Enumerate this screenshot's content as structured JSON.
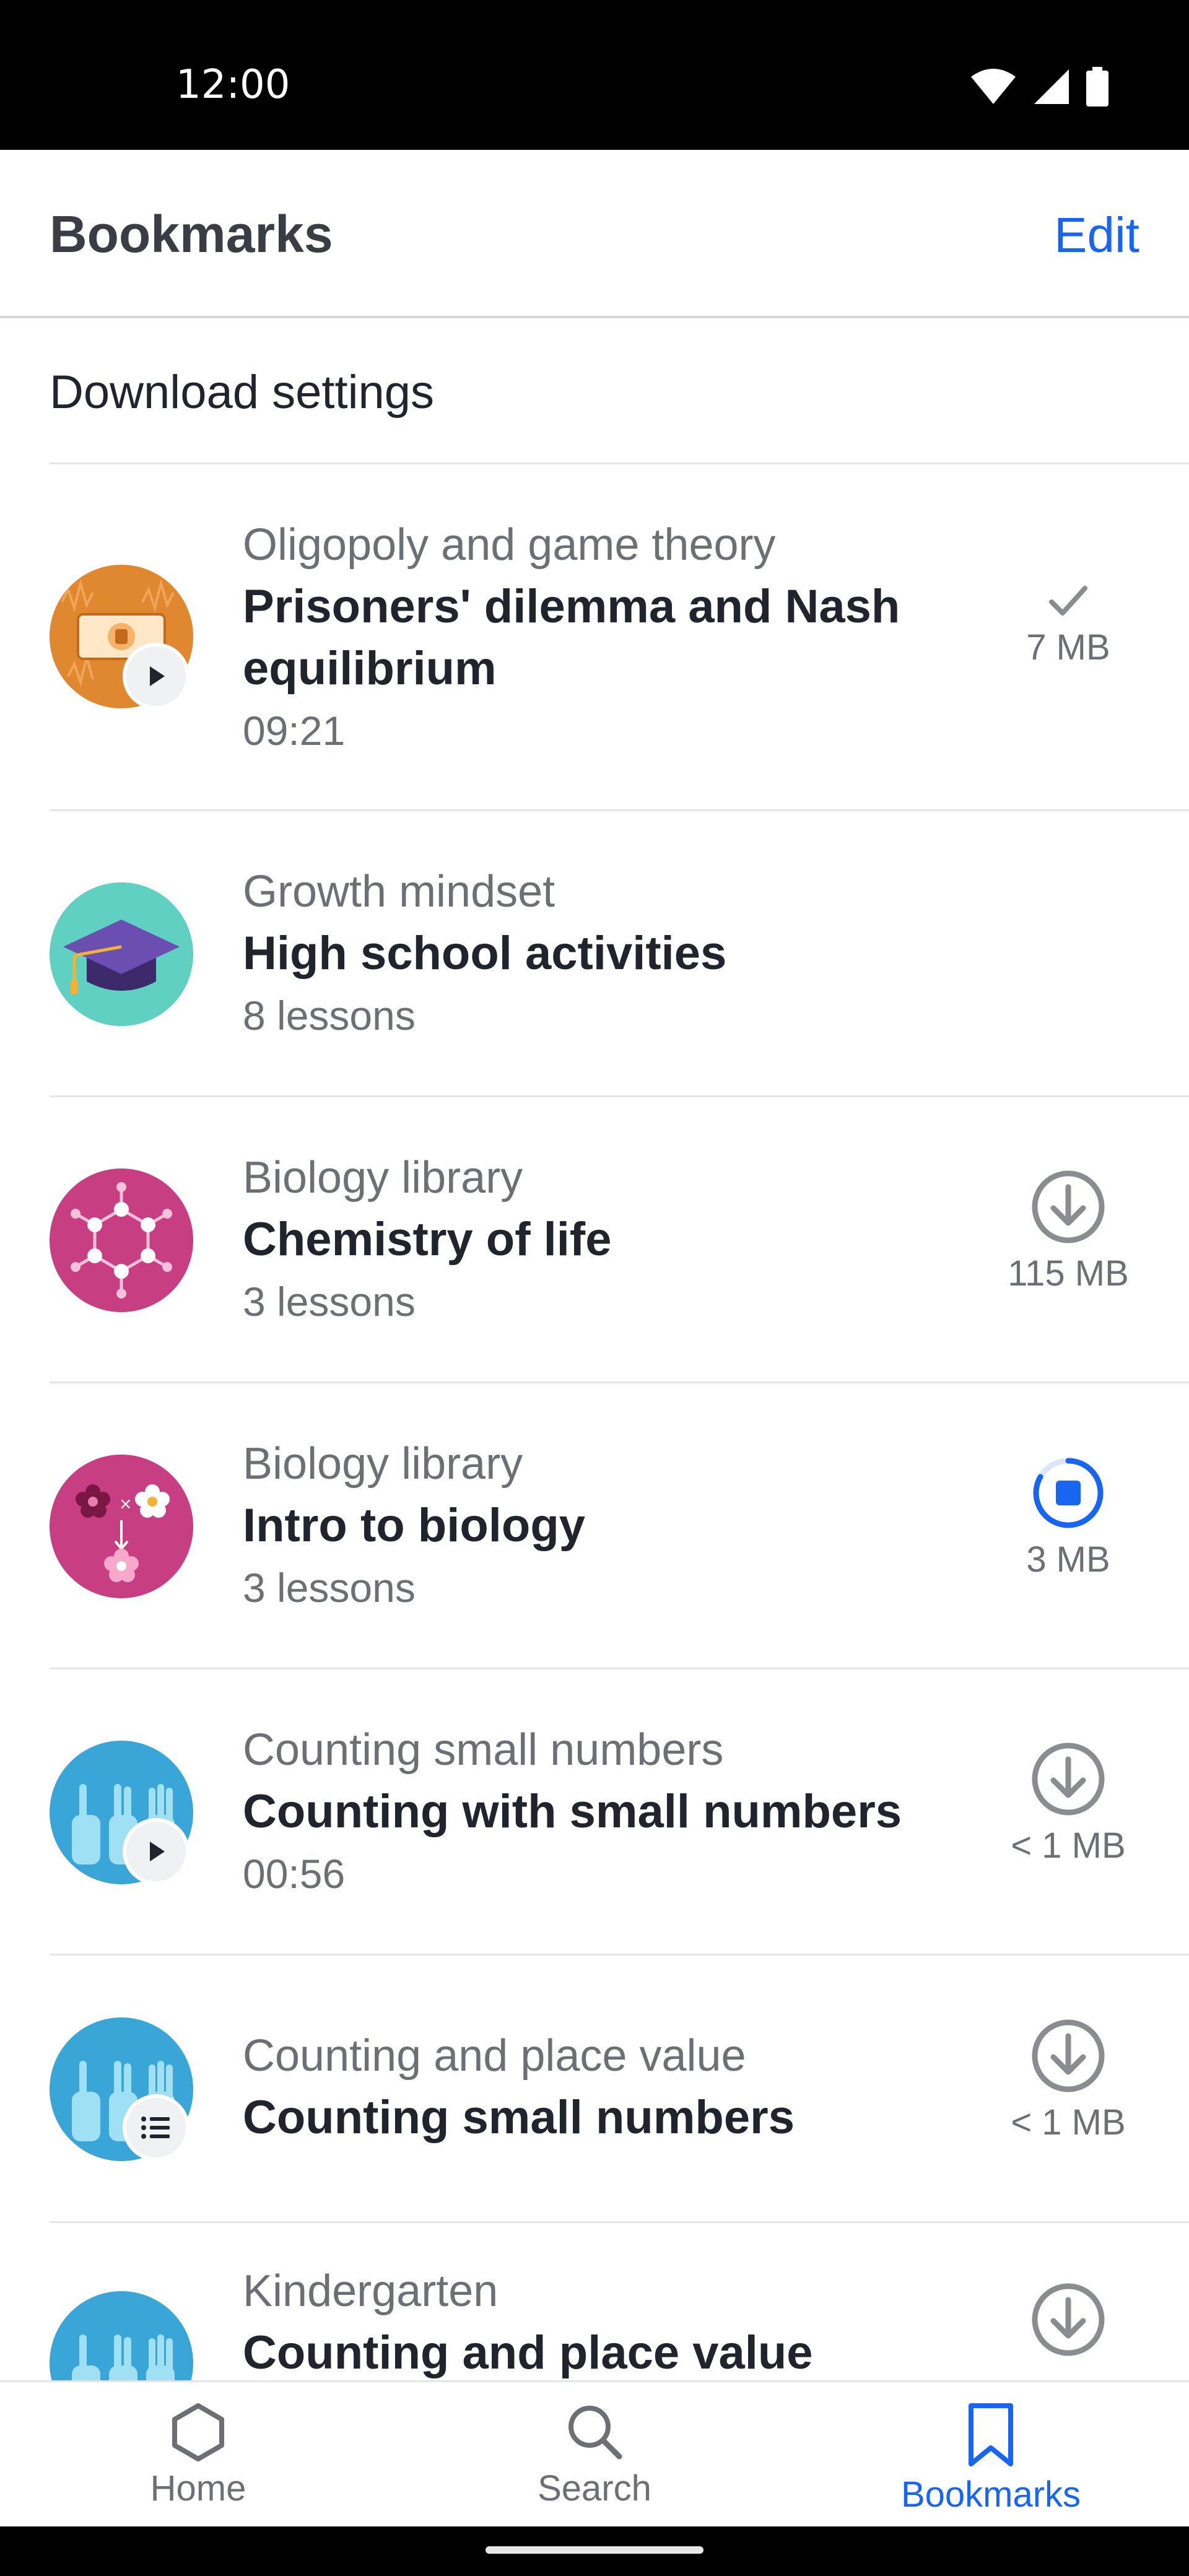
{
  "status_bar": {
    "time": "12:00"
  },
  "header": {
    "title": "Bookmarks",
    "edit_label": "Edit"
  },
  "download_settings_label": "Download settings",
  "colors": {
    "accent": "#1865f2",
    "text": "#21242c",
    "secondary_text": "#6d6f74"
  },
  "bookmarks": [
    {
      "parent": "Oligopoly and game theory",
      "title": "Prisoners' dilemma and Nash equilibrium",
      "meta": "09:21",
      "type": "video",
      "status": "downloaded",
      "status_icon": "check-icon",
      "size": "7 MB"
    },
    {
      "parent": "Growth mindset",
      "title": "High school activities",
      "meta": "8 lessons",
      "type": "course",
      "status": "none",
      "size": ""
    },
    {
      "parent": "Biology library",
      "title": "Chemistry of life",
      "meta": "3 lessons",
      "type": "course",
      "status": "available",
      "status_icon": "download-icon",
      "size": "115 MB"
    },
    {
      "parent": "Biology library",
      "title": "Intro to biology",
      "meta": "3 lessons",
      "type": "course",
      "status": "downloading",
      "status_icon": "stop-download-icon",
      "size": "3 MB"
    },
    {
      "parent": "Counting small numbers",
      "title": "Counting with small numbers",
      "meta": "00:56",
      "type": "video",
      "status": "available",
      "status_icon": "download-icon",
      "size": "< 1 MB"
    },
    {
      "parent": "Counting and place value",
      "title": "Counting small numbers",
      "meta": "",
      "type": "unit",
      "status": "available",
      "status_icon": "download-icon",
      "size": "< 1 MB"
    },
    {
      "parent": "Kindergarten",
      "title": "Counting and place value",
      "meta": "",
      "type": "course",
      "status": "available",
      "status_icon": "download-icon",
      "size": ""
    }
  ],
  "bottom_nav": [
    {
      "label": "Home",
      "icon": "hexagon-icon",
      "active": false
    },
    {
      "label": "Search",
      "icon": "search-icon",
      "active": false
    },
    {
      "label": "Bookmarks",
      "icon": "bookmark-icon",
      "active": true
    }
  ]
}
